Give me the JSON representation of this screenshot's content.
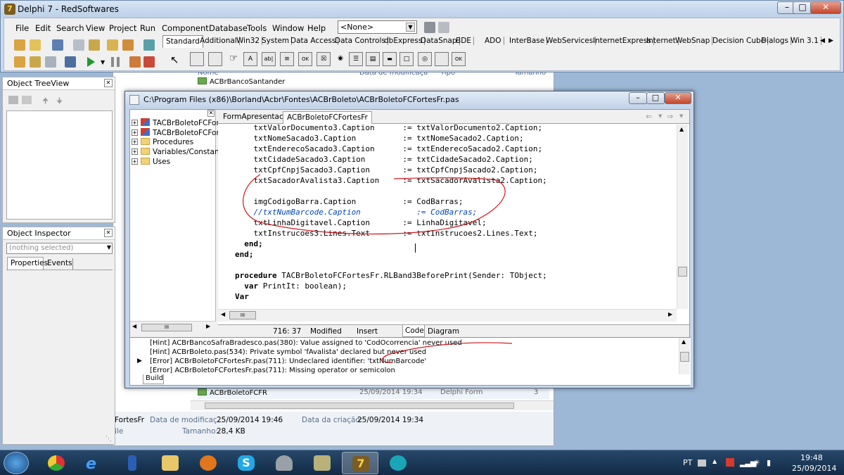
{
  "window": {
    "title": "Delphi 7 - RedSoftwares",
    "app_icon": "delphi-icon"
  },
  "menu": [
    "File",
    "Edit",
    "Search",
    "View",
    "Project",
    "Run",
    "Component",
    "Database",
    "Tools",
    "Window",
    "Help"
  ],
  "toolbar": {
    "desktop_select": "<None>"
  },
  "palette_tabs": [
    "Standard",
    "Additional",
    "Win32",
    "System",
    "Data Access",
    "Data Controls",
    "dbExpress",
    "DataSnap",
    "BDE",
    "ADO",
    "InterBase",
    "WebServices",
    "InternetExpress",
    "Internet",
    "WebSnap",
    "Decision Cube",
    "Dialogs",
    "Win 3.1"
  ],
  "object_treeview": {
    "title": "Object TreeView"
  },
  "object_inspector": {
    "title": "Object Inspector",
    "selected": "(nothing selected)",
    "tabs": [
      "Properties",
      "Events"
    ]
  },
  "explorer": {
    "header": {
      "name": "Nome",
      "date": "Data de modificaçã",
      "type": "Tipo",
      "size": "Tamanho"
    },
    "row_top": {
      "name": "ACBrBancoSantander"
    },
    "row_bottom": {
      "name": "ACBrBoletoFCFR",
      "date": "25/09/2014 19:34",
      "type": "Delphi Form",
      "size": "3"
    },
    "details": {
      "name_suffix": "FortesFr",
      "mod_label": "Data de modificaç...",
      "mod_value": "25/09/2014 19:46",
      "created_label": "Data da criação:",
      "created_value": "25/09/2014 19:34",
      "size_label": "Tamanho:",
      "size_value": "28,4 KB",
      "type_frag": "ile"
    }
  },
  "editor": {
    "title": "C:\\Program Files (x86)\\Borland\\Acbr\\Fontes\\ACBrBoleto\\ACBrBoletoFCFortesFr.pas",
    "tabs": [
      "FormApresentacao",
      "ACBrBoletoFCFortesFr"
    ],
    "tree": [
      "TACBrBoletoFCForte",
      "TACBrBoletoFCForte",
      "Procedures",
      "Variables/Constants",
      "Uses"
    ],
    "code": [
      {
        "text": "    txtValorDocumento3.Caption      := txtValorDocumento2.Caption;",
        "style": "n"
      },
      {
        "text": "    txtNomeSacado3.Caption          := txtNomeSacado2.Caption;",
        "style": "n"
      },
      {
        "text": "    txtEnderecoSacado3.Caption      := txtEnderecoSacado2.Caption;",
        "style": "n"
      },
      {
        "text": "    txtCidadeSacado3.Caption        := txtCidadeSacado2.Caption;",
        "style": "n"
      },
      {
        "text": "    txtCpfCnpjSacado3.Caption       := txtCpfCnpjSacado2.Caption;",
        "style": "n"
      },
      {
        "text": "    txtSacadorAvalista3.Caption     := txtSacadorAvalista2.Caption;",
        "style": "n"
      },
      {
        "text": "",
        "style": "n"
      },
      {
        "text": "    imgCodigoBarra.Caption          := CodBarras;",
        "style": "n"
      },
      {
        "text": "    //txtNumBarcode.Caption            := CodBarras;",
        "style": "c"
      },
      {
        "text": "    txtLinhaDigitavel.Caption       := LinhaDigitavel;",
        "style": "n"
      },
      {
        "text": "    txtInstrucoes3.Lines.Text       := txtInstrucoes2.Lines.Text;",
        "style": "n"
      },
      {
        "text": "  end;",
        "style": "k"
      },
      {
        "text": "end;",
        "style": "k"
      },
      {
        "text": "",
        "style": "n"
      },
      {
        "text": "procedure TACBrBoletoFCFortesFr.RLBand3BeforePrint(Sender: TObject;",
        "style": "p"
      },
      {
        "text": "  var PrintIt: boolean);",
        "style": "v"
      },
      {
        "text": "Var",
        "style": "k"
      }
    ],
    "status": {
      "position": "716:  37",
      "modified": "Modified",
      "mode": "Insert",
      "code_tab": "Code",
      "diagram_tab": "Diagram"
    },
    "messages": [
      {
        "text": "[Hint] ACBrBancoSafraBradesco.pas(380): Value assigned to 'CodOcorrencia' never used",
        "current": false
      },
      {
        "text": "[Hint] ACBrBoleto.pas(534): Private symbol 'fAvalista' declared but never used",
        "current": false
      },
      {
        "text": "[Error] ACBrBoletoFCFortesFr.pas(711): Undeclared identifier: 'txtNumBarcode'",
        "current": true
      },
      {
        "text": "[Error] ACBrBoletoFCFortesFr.pas(711): Missing operator or semicolon",
        "current": false
      }
    ],
    "build_tab": "Build"
  },
  "taskbar": {
    "lang": "PT",
    "time": "19:48",
    "date": "25/09/2014",
    "delphi_active": "7"
  }
}
